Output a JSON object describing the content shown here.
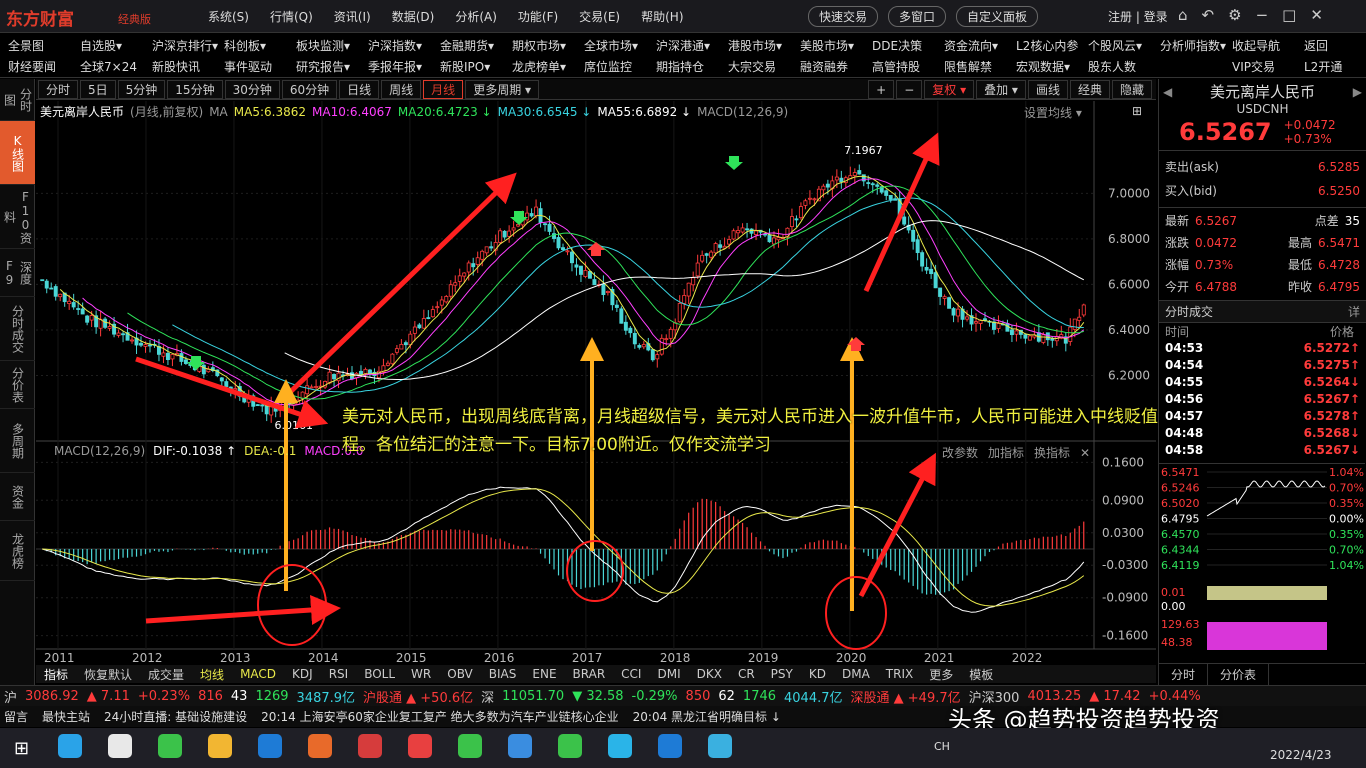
{
  "titlebar": {
    "logo": "东方财富",
    "edition": "经典版",
    "menu": [
      "系统(S)",
      "行情(Q)",
      "资讯(I)",
      "数据(D)",
      "分析(A)",
      "功能(F)",
      "交易(E)",
      "帮助(H)"
    ],
    "right_buttons": [
      "快速交易",
      "多窗口",
      "自定义面板"
    ],
    "login": "注册 | 登录"
  },
  "quicknav": {
    "row1": [
      "全景图",
      "自选股▾",
      "沪深京排行▾",
      "科创板▾",
      "板块监测▾",
      "沪深指数▾",
      "金融期货▾",
      "期权市场▾",
      "全球市场▾",
      "沪深港通▾",
      "港股市场▾",
      "美股市场▾",
      "DDE决策",
      "资金流向▾",
      "L2核心内参",
      "个股风云▾",
      "分析师指数▾",
      "收起导航",
      "返回"
    ],
    "row2": [
      "财经要闻",
      "全球7×24",
      "新股快讯",
      "事件驱动",
      "研究报告▾",
      "季报年报▾",
      "新股IPO▾",
      "龙虎榜单▾",
      "席位监控",
      "期指持仓",
      "大宗交易",
      "融资融券",
      "高管持股",
      "限售解禁",
      "宏观数据▾",
      "股东人数",
      "",
      "VIP交易",
      "L2开通"
    ]
  },
  "sidebar": [
    {
      "label": "分时图"
    },
    {
      "label": "K线图",
      "active": true
    },
    {
      "label": "F10资料"
    },
    {
      "label": "深度F9"
    },
    {
      "label": "分时成交"
    },
    {
      "label": "分价表"
    },
    {
      "label": "多周期"
    },
    {
      "label": "资金"
    },
    {
      "label": "龙虎榜"
    }
  ],
  "periods": [
    "分时",
    "5日",
    "5分钟",
    "15分钟",
    "30分钟",
    "60分钟",
    "日线",
    "周线",
    "月线",
    "更多周期 ▾"
  ],
  "period_active": "月线",
  "toolbar_right": [
    "+",
    "−",
    "复权 ▾",
    "叠加 ▾",
    "画线",
    "经典",
    "隐藏"
  ],
  "info": {
    "name": "美元离岸人民币",
    "mode": "(月线,前复权)",
    "ma_label": "MA",
    "ma5": "MA5:6.3862",
    "ma10": "MA10:6.4067",
    "ma20": "MA20:6.4723 ↓",
    "ma30": "MA30:6.6545 ↓",
    "ma55": "MA55:6.6892 ↓",
    "macd": "MACD(12,26,9)",
    "settings": "设置均线 ▾"
  },
  "macd_info": {
    "name": "MACD(12,26,9)",
    "dif": "DIF:-0.1038 ↑",
    "dea": "DEA:-0.1",
    "macd": "MACD:0.0",
    "right": [
      "改参数",
      "加指标",
      "换指标"
    ]
  },
  "chart_data": {
    "type": "candlestick",
    "price_axis": [
      "7.0000",
      "6.8000",
      "6.6000",
      "6.4000",
      "6.2000"
    ],
    "macd_axis": [
      "0.1600",
      "0.0900",
      "0.0300",
      "-0.0300",
      "-0.0900",
      "-0.1600"
    ],
    "x_labels": [
      "2011",
      "2012",
      "2013",
      "2014",
      "2015",
      "2016",
      "2017",
      "2018",
      "2019",
      "2020",
      "2021",
      "2022"
    ],
    "high_label": "7.1967",
    "low_label": "6.0161",
    "annotation": "美元对人民币，出现周线底背离，月线超级信号，美元对人民币进入一波升值牛市，人民币可能进入中线贬值过程。各位结汇的注意一下。目标7.00附近。仅作交流学习"
  },
  "indicator_tabs": [
    "指标",
    "恢复默认",
    "成交量",
    "均线",
    "MACD",
    "KDJ",
    "RSI",
    "BOLL",
    "WR",
    "OBV",
    "BIAS",
    "ENE",
    "BRAR",
    "CCI",
    "DMI",
    "DKX",
    "CR",
    "PSY",
    "KD",
    "DMA",
    "TRIX",
    "更多",
    "模板"
  ],
  "quote": {
    "name": "美元离岸人民币",
    "code": "USDCNH",
    "price": "6.5267",
    "change": "+0.0472",
    "pct": "+0.73%",
    "ask_label": "卖出(ask)",
    "ask": "6.5285",
    "bid_label": "买入(bid)",
    "bid": "6.5250",
    "rows": [
      [
        "最新",
        "6.5267",
        "点差",
        "35"
      ],
      [
        "涨跌",
        "0.0472",
        "最高",
        "6.5471"
      ],
      [
        "涨幅",
        "0.73%",
        "最低",
        "6.4728"
      ],
      [
        "今开",
        "6.4788",
        "昨收",
        "6.4795"
      ]
    ],
    "ticks_title": "分时成交",
    "ticks_more": "详",
    "ticks_head": [
      "时间",
      "价格"
    ],
    "ticks": [
      [
        "04:53",
        "6.5272↑"
      ],
      [
        "04:54",
        "6.5275↑"
      ],
      [
        "04:55",
        "6.5264↓"
      ],
      [
        "04:56",
        "6.5267↑"
      ],
      [
        "04:57",
        "6.5278↑"
      ],
      [
        "04:48",
        "6.5268↓"
      ],
      [
        "04:58",
        "6.5267↓"
      ]
    ],
    "mini_left": [
      "6.5471",
      "6.5246",
      "6.5020",
      "6.4795",
      "6.4570",
      "6.4344",
      "6.4119"
    ],
    "mini_right": [
      "1.04%",
      "0.70%",
      "0.35%",
      "0.00%",
      "0.35%",
      "0.70%",
      "1.04%"
    ],
    "mini_vol": [
      "0.01",
      "0.00",
      "129.63",
      "48.38"
    ],
    "bottom_tabs": [
      "分时",
      "分价表"
    ]
  },
  "ticker": {
    "sh_label": "沪",
    "sh": "3086.92",
    "sh_chg": "▲ 7.11",
    "sh_pct": "+0.23%",
    "sh_up": "816",
    "sh_flat": "43",
    "sh_down": "1269",
    "sh_amt": "3487.9亿",
    "sh_hk": "沪股通 ▲ +50.6亿",
    "sz_label": "深",
    "sz": "11051.70",
    "sz_chg": "▼ 32.58",
    "sz_pct": "-0.29%",
    "sz_up": "850",
    "sz_flat": "62",
    "sz_down": "1746",
    "sz_amt": "4044.7亿",
    "sz_hk": "深股通 ▲ +49.7亿",
    "hs_label": "沪深300",
    "hs": "4013.25",
    "hs_chg": "▲ 17.42",
    "hs_pct": "+0.44%"
  },
  "news": [
    "留言",
    "最快主站",
    "24小时直播: 基础设施建设",
    "20:14 上海安亭60家企业复工复产 绝大多数为汽车产业链核心企业",
    "20:04 黑龙江省明确目标 ↓"
  ],
  "watermark": "头条 @趋势投资趋势投资",
  "taskbar": {
    "ime": "CH",
    "date": "2022/4/23"
  }
}
